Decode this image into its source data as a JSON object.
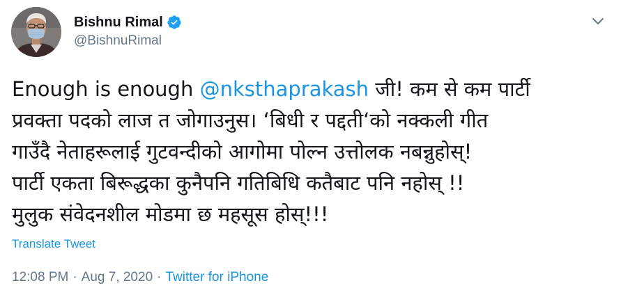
{
  "user": {
    "display_name": "Bishnu Rimal",
    "handle": "@BishnuRimal",
    "verified": true
  },
  "tweet": {
    "lines": [
      {
        "pre": "Enough is enough ",
        "mention": "@nksthaprakash",
        "post": " जी! कम से कम पार्टी"
      },
      {
        "text": "प्रवक्ता पदको लाज त जोगाउनुस। ‘बिधी र पद्दती‘को नक्कली गीत"
      },
      {
        "text": "गाउँदै नेताहरूलाई गुटवन्दीको आगोमा पोल्न उत्तोलक नबन्नुहोस्!"
      },
      {
        "text": "पार्टी एकता बिरूद्धका कुनैपनि गतिबिधि कतैबाट पनि नहोस् !!"
      },
      {
        "text": "मुलुक संवेदनशील मोडमा छ महसूस होस्!!!"
      }
    ]
  },
  "translate_label": "Translate Tweet",
  "meta": {
    "time": "12:08 PM",
    "separator1": "·",
    "date": "Aug 7, 2020",
    "separator2": "·",
    "source": "Twitter for iPhone"
  },
  "colors": {
    "link": "#1b95e0",
    "muted": "#657786",
    "text": "#14171a",
    "verified": "#1da1f2"
  },
  "icons": {
    "verified": "verified-badge-icon",
    "caret": "chevron-down-icon"
  }
}
